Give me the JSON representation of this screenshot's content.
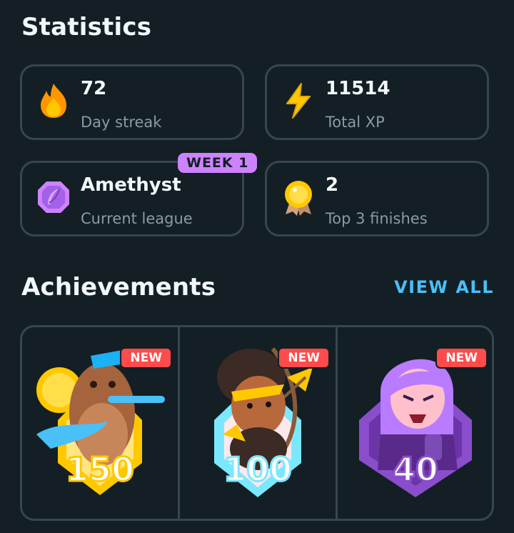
{
  "statistics": {
    "title": "Statistics",
    "cards": [
      {
        "value": "72",
        "label": "Day streak",
        "icon": "flame-icon"
      },
      {
        "value": "11514",
        "label": "Total XP",
        "icon": "lightning-icon"
      },
      {
        "value": "Amethyst",
        "label": "Current league",
        "icon": "amethyst-league-icon",
        "badge": "WEEK 1"
      },
      {
        "value": "2",
        "label": "Top 3 finishes",
        "icon": "medal-icon"
      }
    ]
  },
  "achievements": {
    "title": "Achievements",
    "view_all": "VIEW ALL",
    "items": [
      {
        "badge": "NEW",
        "number": "150",
        "ring_color": "#ffd900",
        "icon": "sea-lion-achievement-icon"
      },
      {
        "badge": "NEW",
        "number": "100",
        "ring_color": "#7be8ff",
        "icon": "archer-achievement-icon"
      },
      {
        "badge": "NEW",
        "number": "40",
        "ring_color": "#8a4dcc",
        "icon": "lily-achievement-icon"
      }
    ]
  },
  "colors": {
    "background": "#131f24",
    "border": "#37464f",
    "accent_blue": "#49c0f8",
    "league_purple": "#ce82ff",
    "new_red": "#ff4b4b",
    "muted_text": "#8a9ba5"
  }
}
